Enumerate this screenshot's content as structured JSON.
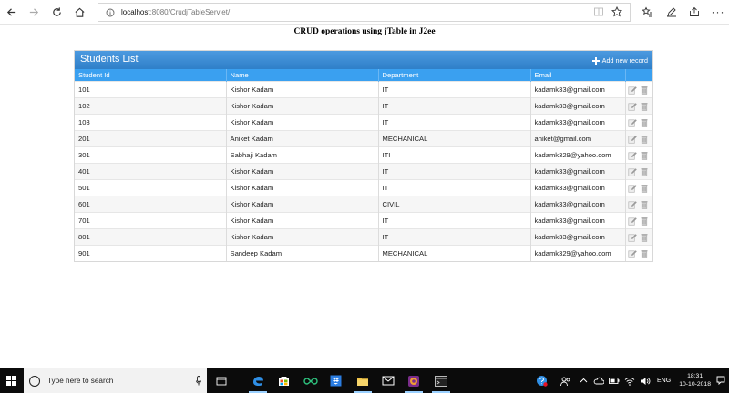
{
  "browser": {
    "url_host": "localhost",
    "url_path": ":8080/CrudjTableServlet/"
  },
  "page": {
    "heading": "CRUD operations using jTable in J2ee"
  },
  "table": {
    "title": "Students List",
    "add_label": "Add new record",
    "columns": [
      "Student Id",
      "Name",
      "Department",
      "Email"
    ],
    "rows": [
      {
        "id": "101",
        "name": "Kishor Kadam",
        "dept": "IT",
        "email": "kadamk33@gmail.com"
      },
      {
        "id": "102",
        "name": "Kishor Kadam",
        "dept": "IT",
        "email": "kadamk33@gmail.com"
      },
      {
        "id": "103",
        "name": "Kishor Kadam",
        "dept": "IT",
        "email": "kadamk33@gmail.com"
      },
      {
        "id": "201",
        "name": "Aniket Kadam",
        "dept": "MECHANICAL",
        "email": "aniket@gmail.com"
      },
      {
        "id": "301",
        "name": "Sabhaji Kadam",
        "dept": "ITI",
        "email": "kadamk329@yahoo.com"
      },
      {
        "id": "401",
        "name": "Kishor Kadam",
        "dept": "IT",
        "email": "kadamk33@gmail.com"
      },
      {
        "id": "501",
        "name": "Kishor Kadam",
        "dept": "IT",
        "email": "kadamk33@gmail.com"
      },
      {
        "id": "601",
        "name": "Kishor Kadam",
        "dept": "CIVIL",
        "email": "kadamk33@gmail.com"
      },
      {
        "id": "701",
        "name": "Kishor Kadam",
        "dept": "IT",
        "email": "kadamk33@gmail.com"
      },
      {
        "id": "801",
        "name": "Kishor Kadam",
        "dept": "IT",
        "email": "kadamk33@gmail.com"
      },
      {
        "id": "901",
        "name": "Sandeep Kadam",
        "dept": "MECHANICAL",
        "email": "kadamk329@yahoo.com"
      }
    ]
  },
  "taskbar": {
    "search_placeholder": "Type here to search",
    "lang": "ENG",
    "time": "18:31",
    "date": "10-10-2018"
  },
  "colors": {
    "title_bar": "#3c8ed6",
    "header_row": "#3aa0f0",
    "taskbar": "#0b0b0b"
  }
}
